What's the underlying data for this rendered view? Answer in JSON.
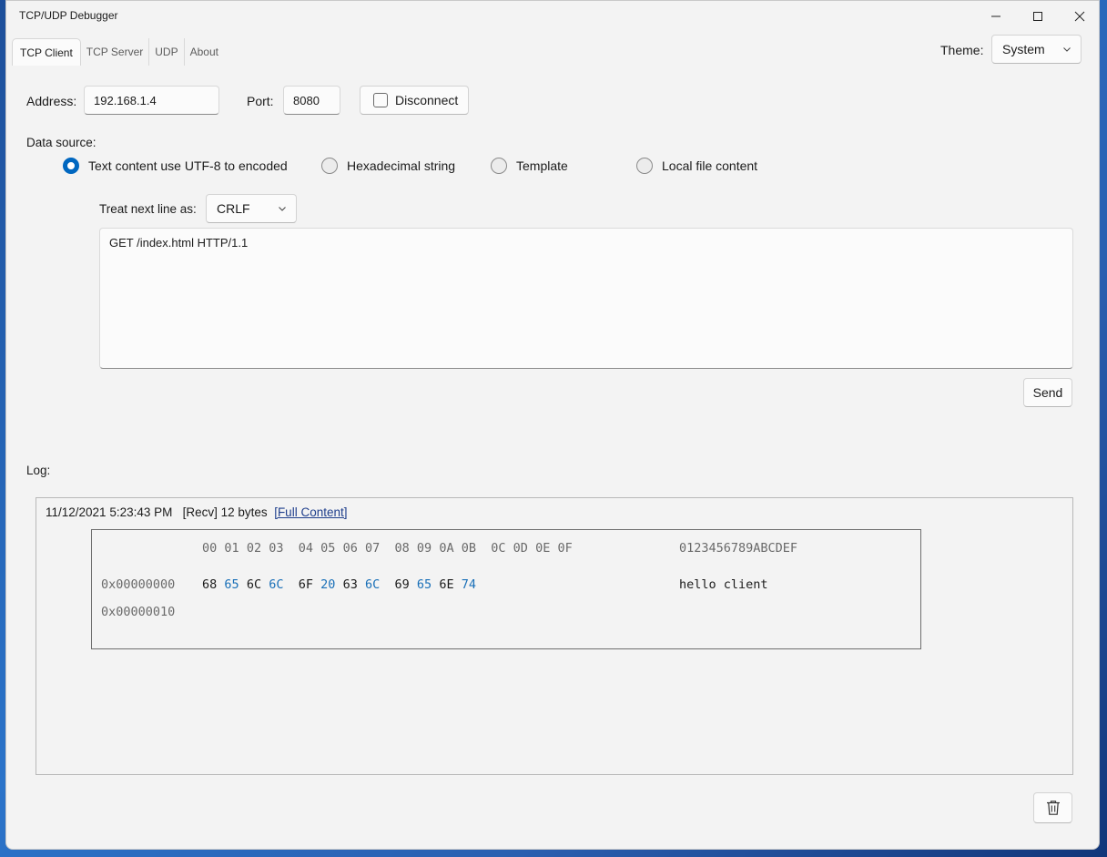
{
  "window": {
    "title": "TCP/UDP Debugger"
  },
  "tabs": [
    {
      "label": "TCP Client",
      "active": true
    },
    {
      "label": "TCP Server",
      "active": false
    },
    {
      "label": "UDP",
      "active": false
    },
    {
      "label": "About",
      "active": false
    }
  ],
  "theme": {
    "label": "Theme:",
    "value": "System"
  },
  "connection": {
    "address_label": "Address:",
    "address_value": "192.168.1.4",
    "port_label": "Port:",
    "port_value": "8080",
    "disconnect_label": "Disconnect"
  },
  "data_source": {
    "label": "Data source:",
    "options": [
      {
        "label": "Text content use UTF-8 to encoded",
        "selected": true
      },
      {
        "label": "Hexadecimal string",
        "selected": false
      },
      {
        "label": "Template",
        "selected": false
      },
      {
        "label": "Local file content",
        "selected": false
      }
    ]
  },
  "line_ending": {
    "label": "Treat next line as:",
    "value": "CRLF"
  },
  "message": {
    "text": "GET /index.html HTTP/1.1"
  },
  "send_label": "Send",
  "log": {
    "label": "Log:",
    "entry": {
      "timestamp": "11/12/2021 5:23:43 PM",
      "meta": "[Recv] 12 bytes",
      "link": "[Full Content]"
    },
    "hex": {
      "header_cols": [
        "00",
        "01",
        "02",
        "03",
        "04",
        "05",
        "06",
        "07",
        "08",
        "09",
        "0A",
        "0B",
        "0C",
        "0D",
        "0E",
        "0F"
      ],
      "ascii_header": "0123456789ABCDEF",
      "rows": [
        {
          "offset": "0x00000000",
          "bytes": [
            "68",
            "65",
            "6C",
            "6C",
            "6F",
            "20",
            "63",
            "6C",
            "69",
            "65",
            "6E",
            "74"
          ],
          "ascii": "hello client"
        },
        {
          "offset": "0x00000010",
          "bytes": [],
          "ascii": ""
        }
      ]
    }
  },
  "colors": {
    "accent": "#0067c0",
    "odd_byte": "#1a70b8",
    "link": "#1e3e8c"
  },
  "icons": {
    "delete": "trash-icon"
  }
}
